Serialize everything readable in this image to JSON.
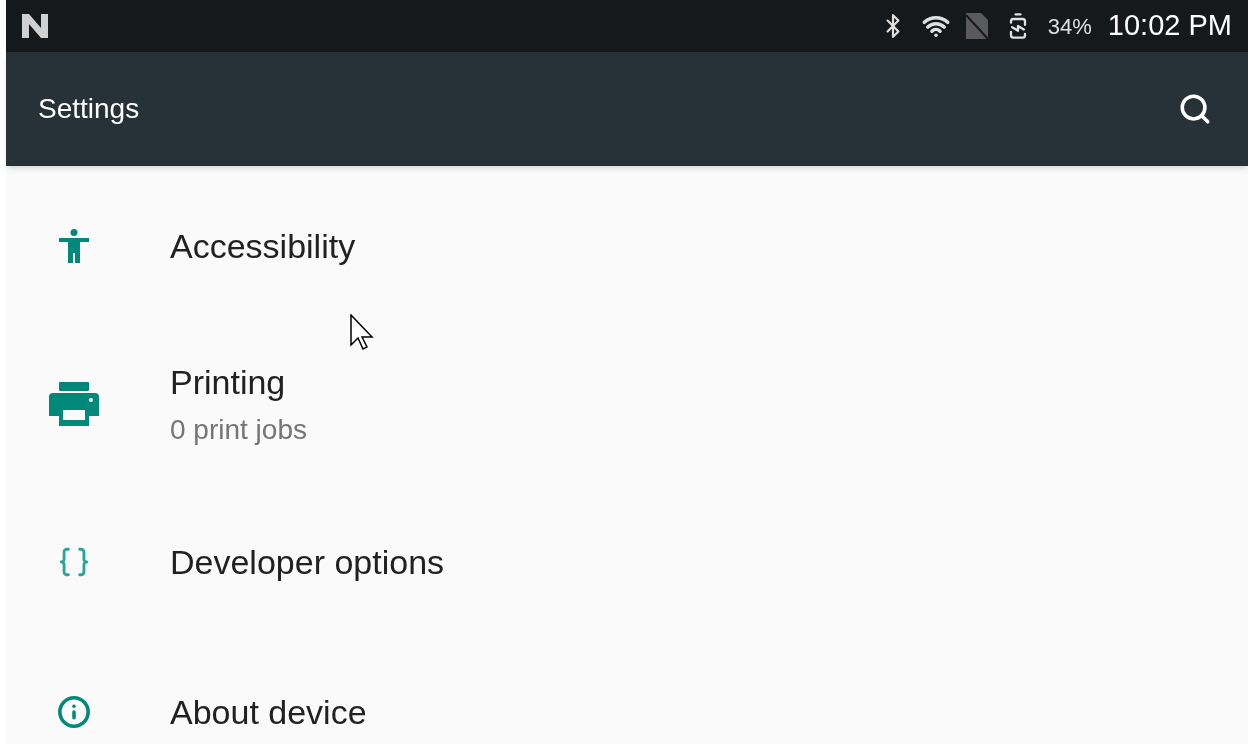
{
  "status_bar": {
    "battery": "34%",
    "time": "10:02 PM"
  },
  "toolbar": {
    "title": "Settings"
  },
  "items": [
    {
      "kind": "accessibility",
      "title": "Accessibility"
    },
    {
      "kind": "printing",
      "title": "Printing",
      "summary": "0 print jobs"
    },
    {
      "kind": "developer",
      "title": "Developer options"
    },
    {
      "kind": "about",
      "title": "About device"
    }
  ]
}
